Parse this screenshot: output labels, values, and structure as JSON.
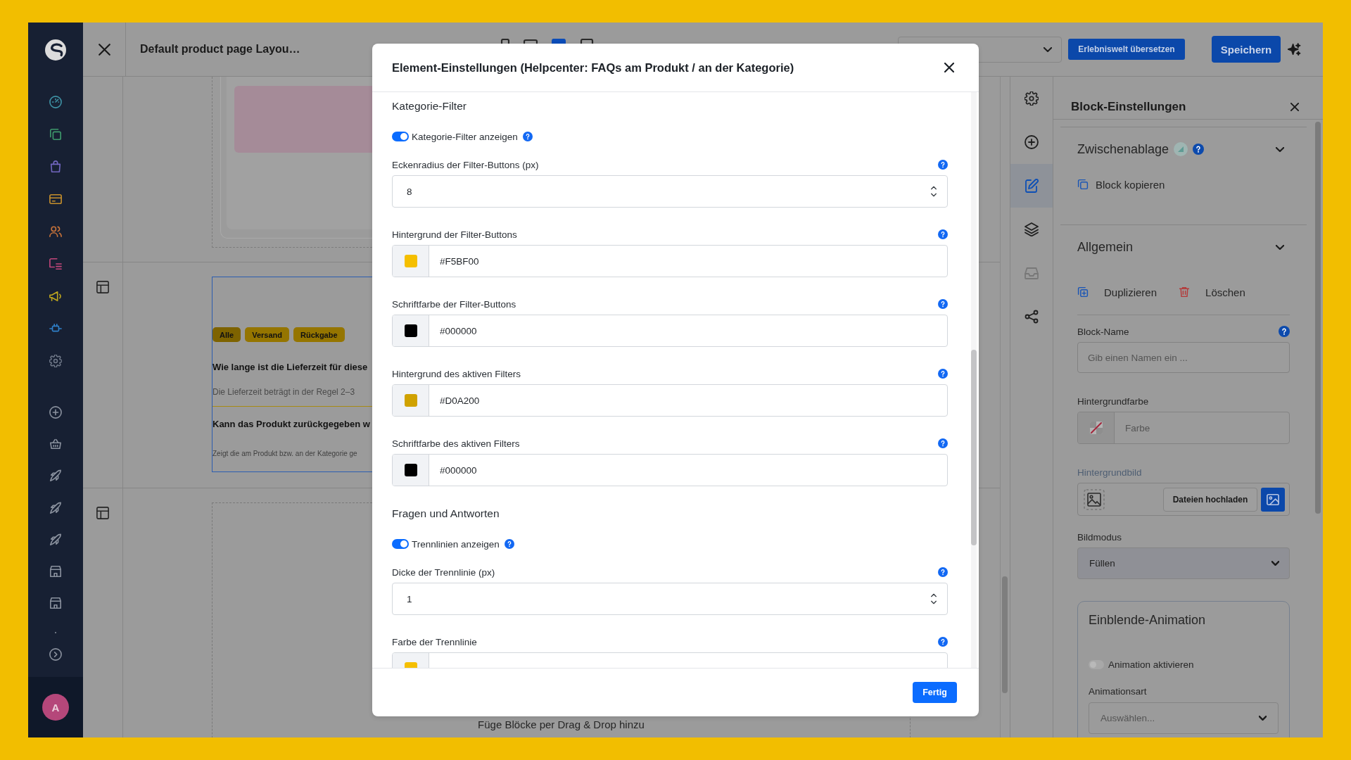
{
  "top_bar": {
    "title": "Default product page Layou…",
    "viewports": [
      {
        "selected": false
      },
      {
        "selected": false
      },
      {
        "selected": true
      },
      {
        "selected": false
      }
    ],
    "translate_button": "Erlebniswelt übersetzen",
    "save_button": "Speichern"
  },
  "sidebar": {
    "avatar": "A"
  },
  "canvas": {
    "sections": [
      {
        "kind": "preview"
      },
      {
        "kind": "faq",
        "filters": [
          {
            "label": "Alle",
            "selected": true
          },
          {
            "label": "Versand",
            "selected": false
          },
          {
            "label": "Rückgabe",
            "selected": false
          }
        ],
        "questions": [
          {
            "question": "Wie lange ist die Lieferzeit für diese",
            "answer": "Die Lieferzeit beträgt in der Regel 2–3"
          },
          {
            "question": "Kann das Produkt zurückgegeben w"
          }
        ],
        "note": "Zeigt die am Produkt bzw. an der Kategorie ge"
      },
      {
        "kind": "dropzone",
        "hint": "Füge Blöcke per Drag & Drop hinzu"
      }
    ]
  },
  "modal": {
    "title": "Element-Einstellungen (Helpcenter: FAQs am Produkt / an der Kategorie)",
    "fields": [
      {
        "kind": "section",
        "label": "Kategorie-Filter"
      },
      {
        "kind": "toggle",
        "label": "Kategorie-Filter anzeigen",
        "on": true
      },
      {
        "kind": "number",
        "label": "Eckenradius der Filter-Buttons (px)",
        "value": "8"
      },
      {
        "kind": "color",
        "label": "Hintergrund der Filter-Buttons",
        "value": "#F5BF00",
        "color": "#f5bf00"
      },
      {
        "kind": "color",
        "label": "Schriftfarbe der Filter-Buttons",
        "value": "#000000",
        "color": "#000000"
      },
      {
        "kind": "color",
        "label": "Hintergrund des aktiven Filters",
        "value": "#D0A200",
        "color": "#d0a200"
      },
      {
        "kind": "color",
        "label": "Schriftfarbe des aktiven Filters",
        "value": "#000000",
        "color": "#000000"
      },
      {
        "kind": "section",
        "label": "Fragen und Antworten"
      },
      {
        "kind": "toggle",
        "label": "Trennlinien anzeigen",
        "on": true
      },
      {
        "kind": "number",
        "label": "Dicke der Trennlinie (px)",
        "value": "1"
      },
      {
        "kind": "color",
        "label": "Farbe der Trennlinie",
        "color": "#f5bf00"
      }
    ],
    "done_button": "Fertig"
  },
  "tool_rail": {
    "items": [
      {
        "selected": false,
        "disabled": false
      },
      {
        "selected": false,
        "disabled": false
      },
      {
        "selected": true,
        "disabled": false
      },
      {
        "selected": false,
        "disabled": false
      },
      {
        "selected": false,
        "disabled": true
      },
      {
        "selected": false,
        "disabled": false
      }
    ]
  },
  "block_settings": {
    "title": "Block-Einstellungen",
    "sections": [
      {
        "title": "Zwischenablage",
        "expanded": true,
        "badge": true,
        "help": true,
        "actions": [
          {
            "kind": "copy",
            "label": "Block kopieren"
          }
        ]
      },
      {
        "title": "Allgemein",
        "expanded": true,
        "badge": false,
        "help": false,
        "actions": [
          {
            "kind": "duplicate",
            "label": "Duplizieren"
          },
          {
            "kind": "delete",
            "label": "Löschen"
          }
        ],
        "fields": [
          {
            "kind": "text",
            "label": "Block-Name",
            "help": true,
            "placeholder": "Gib einen Namen ein ..."
          },
          {
            "kind": "color",
            "label": "Hintergrundfarbe",
            "help": false,
            "placeholder": "Farbe"
          },
          {
            "kind": "image",
            "label": "Hintergrundbild",
            "help": false,
            "button": "Dateien hochladen"
          },
          {
            "kind": "select",
            "label": "Bildmodus",
            "help": false,
            "value": "Füllen"
          }
        ],
        "card": {
          "title": "Einblende-Animation",
          "toggle": {
            "label": "Animation aktivieren",
            "on": false
          },
          "select": {
            "label": "Animationsart",
            "placeholder": "Auswählen..."
          }
        }
      }
    ]
  }
}
